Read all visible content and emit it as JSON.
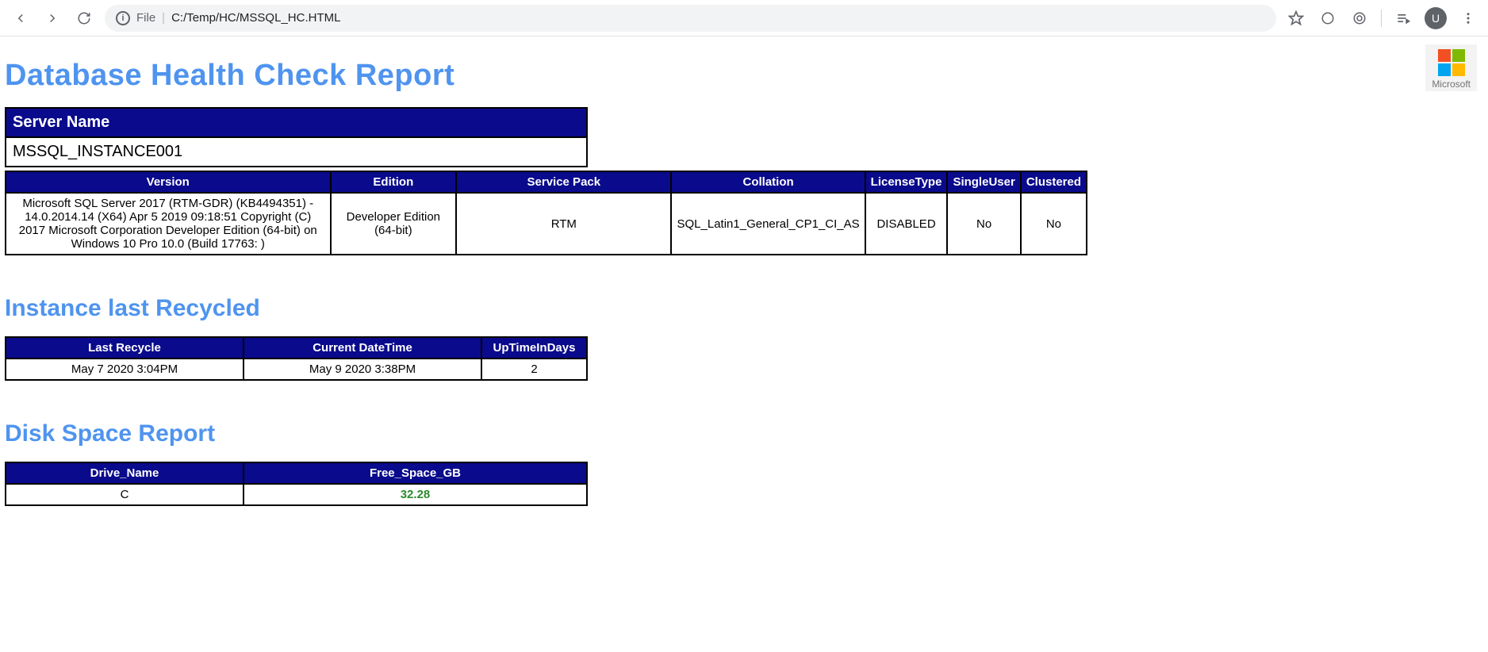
{
  "browser": {
    "url_prefix": "File",
    "url_path": "C:/Temp/HC/MSSQL_HC.HTML",
    "avatar_letter": "U"
  },
  "logo_text": "Microsoft",
  "headings": {
    "title": "Database Health Check Report",
    "section_recycle": "Instance last Recycled",
    "section_disk": "Disk Space Report"
  },
  "server_table": {
    "header": "Server Name",
    "value": "MSSQL_INSTANCE001"
  },
  "version_table": {
    "headers": [
      "Version",
      "Edition",
      "Service Pack",
      "Collation",
      "LicenseType",
      "SingleUser",
      "Clustered"
    ],
    "row": [
      "Microsoft SQL Server 2017 (RTM-GDR) (KB4494351) - 14.0.2014.14 (X64) Apr 5 2019 09:18:51 Copyright (C) 2017 Microsoft Corporation Developer Edition (64-bit) on Windows 10 Pro 10.0 (Build 17763: )",
      "Developer Edition (64-bit)",
      "RTM",
      "SQL_Latin1_General_CP1_CI_AS",
      "DISABLED",
      "No",
      "No"
    ]
  },
  "recycle_table": {
    "headers": [
      "Last Recycle",
      "Current DateTime",
      "UpTimeInDays"
    ],
    "row": [
      "May 7 2020 3:04PM",
      "May 9 2020 3:38PM",
      "2"
    ]
  },
  "disk_table": {
    "headers": [
      "Drive_Name",
      "Free_Space_GB"
    ],
    "row": [
      "C",
      "32.28"
    ]
  }
}
